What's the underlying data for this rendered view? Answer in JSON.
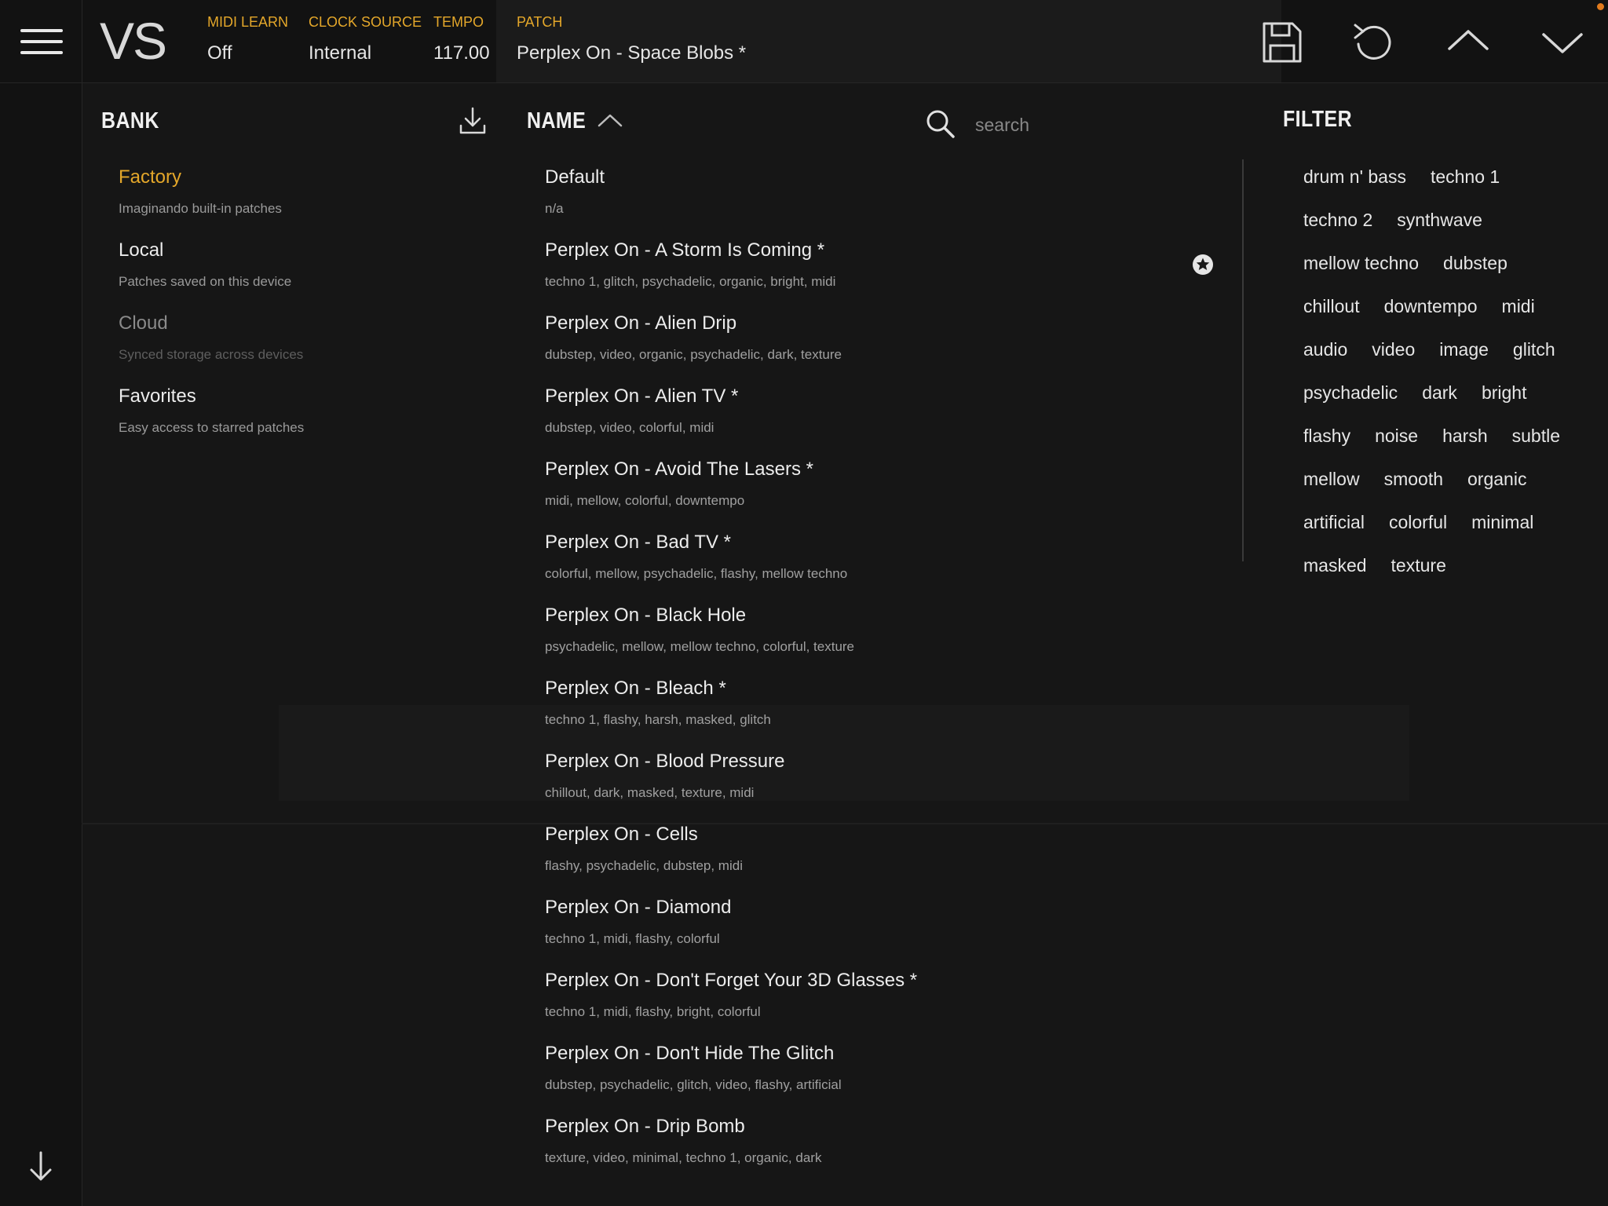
{
  "app": {
    "logo": "VS"
  },
  "topbar": {
    "midi_learn": {
      "label": "MIDI LEARN",
      "value": "Off"
    },
    "clock_source": {
      "label": "CLOCK SOURCE",
      "value": "Internal"
    },
    "tempo": {
      "label": "TEMPO",
      "value": "117.00"
    },
    "patch": {
      "label": "PATCH",
      "value": "Perplex On - Space Blobs *"
    }
  },
  "colors": {
    "accent": "#e4a72a",
    "background": "#161616",
    "status_dot": "#e07a1d"
  },
  "bank": {
    "header": "BANK",
    "items": [
      {
        "title": "Factory",
        "desc": "Imaginando built-in patches",
        "state": "selected"
      },
      {
        "title": "Local",
        "desc": "Patches saved on this device",
        "state": "normal"
      },
      {
        "title": "Cloud",
        "desc": "Synced storage across devices",
        "state": "disabled"
      },
      {
        "title": "Favorites",
        "desc": "Easy access to starred patches",
        "state": "normal"
      }
    ]
  },
  "patches": {
    "header": "NAME",
    "search_placeholder": "search",
    "items": [
      {
        "name": "Default",
        "tags": "n/a"
      },
      {
        "name": "Perplex On - A Storm Is Coming *",
        "tags": "techno 1, glitch, psychadelic, organic, bright, midi",
        "starred": true
      },
      {
        "name": "Perplex On - Alien Drip",
        "tags": "dubstep, video, organic, psychadelic, dark, texture"
      },
      {
        "name": "Perplex On - Alien TV *",
        "tags": "dubstep, video, colorful, midi"
      },
      {
        "name": "Perplex On - Avoid The Lasers *",
        "tags": "midi, mellow, colorful, downtempo"
      },
      {
        "name": "Perplex On - Bad TV *",
        "tags": "colorful, mellow, psychadelic, flashy, mellow techno"
      },
      {
        "name": "Perplex On - Black Hole",
        "tags": "psychadelic, mellow, mellow techno, colorful, texture"
      },
      {
        "name": "Perplex On - Bleach *",
        "tags": "techno 1, flashy, harsh, masked, glitch"
      },
      {
        "name": "Perplex On - Blood Pressure",
        "tags": "chillout, dark, masked, texture, midi"
      },
      {
        "name": "Perplex On - Cells",
        "tags": "flashy, psychadelic, dubstep, midi"
      },
      {
        "name": "Perplex On - Diamond",
        "tags": "techno 1, midi, flashy, colorful"
      },
      {
        "name": "Perplex On - Don't Forget Your 3D Glasses *",
        "tags": "techno 1, midi, flashy, bright, colorful"
      },
      {
        "name": "Perplex On - Don't Hide The Glitch",
        "tags": "dubstep, psychadelic, glitch, video, flashy, artificial"
      },
      {
        "name": "Perplex On - Drip Bomb",
        "tags": "texture, video, minimal, techno 1, organic, dark"
      }
    ]
  },
  "filter": {
    "header": "FILTER",
    "rows": [
      [
        "drum n' bass",
        "techno 1"
      ],
      [
        "techno 2",
        "synthwave"
      ],
      [
        "mellow techno",
        "dubstep"
      ],
      [
        "chillout",
        "downtempo",
        "midi"
      ],
      [
        "audio",
        "video",
        "image",
        "glitch"
      ],
      [
        "psychadelic",
        "dark",
        "bright"
      ],
      [
        "flashy",
        "noise",
        "harsh",
        "subtle"
      ],
      [
        "mellow",
        "smooth",
        "organic"
      ],
      [
        "artificial",
        "colorful",
        "minimal"
      ],
      [
        "masked",
        "texture"
      ]
    ]
  }
}
